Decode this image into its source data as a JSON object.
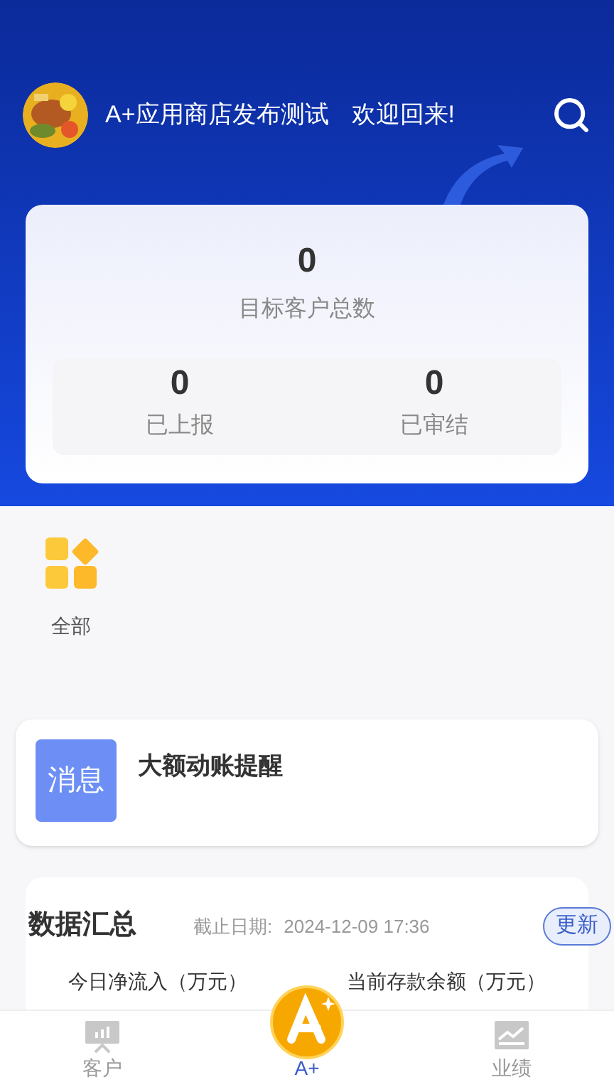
{
  "header": {
    "title": "A+应用商店发布测试",
    "greeting": "欢迎回来!"
  },
  "summary": {
    "total": {
      "value": "0",
      "label": "目标客户总数"
    },
    "stats": [
      {
        "value": "0",
        "label": "已上报"
      },
      {
        "value": "0",
        "label": "已审结"
      }
    ]
  },
  "shortcuts": [
    {
      "label": "全部"
    }
  ],
  "notice": {
    "badge": "消息",
    "title": "大额动账提醒"
  },
  "data_summary": {
    "title": "数据汇总",
    "date_label": "截止日期:",
    "date": "2024-12-09 17:36",
    "button": "更新",
    "metrics": [
      "今日净流入（万元）",
      "当前存款余额（万元）"
    ]
  },
  "tabs": [
    {
      "label": "客户",
      "kind": "customers",
      "selected": false
    },
    {
      "label": "A+",
      "kind": "home",
      "selected": true
    },
    {
      "label": "业绩",
      "kind": "performance",
      "selected": false
    }
  ]
}
